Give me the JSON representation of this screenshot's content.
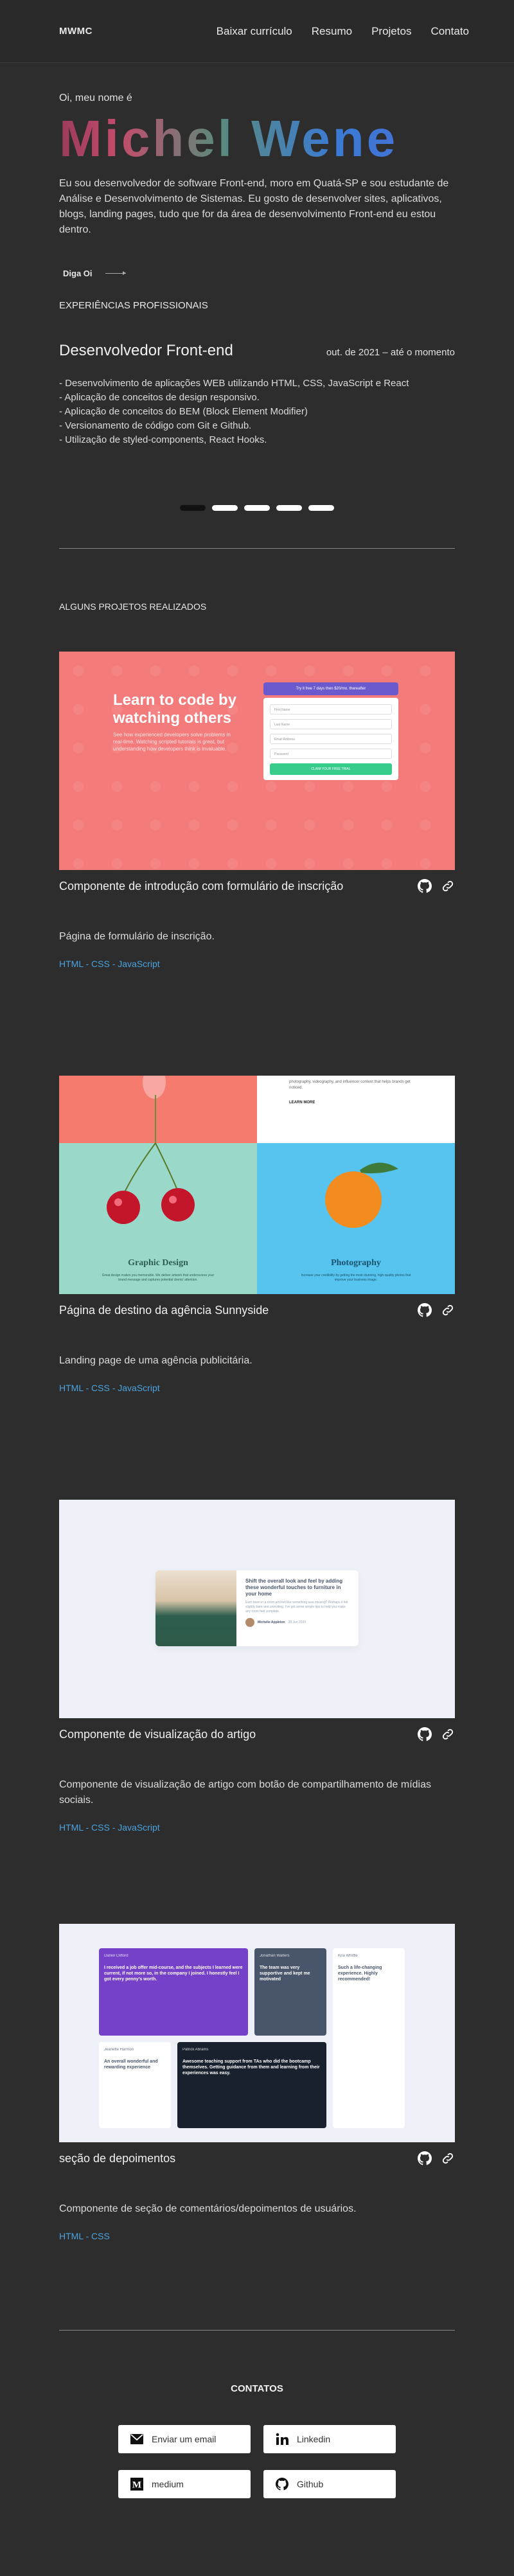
{
  "header": {
    "logo": "MWMC",
    "nav": [
      "Baixar currículo",
      "Resumo",
      "Projetos",
      "Contato"
    ]
  },
  "hero": {
    "greeting": "Oi, meu nome é",
    "name": "Michel Wene",
    "about": "Eu sou desenvolvedor de software Front-end, moro em Quatá-SP e sou estudante de Análise e Desenvolvimento de Sistemas. Eu gosto de desenvolver sites, aplicativos, blogs, landing pages, tudo que for da área de desenvolvimento Front-end eu estou dentro.",
    "say_hi": "Diga Oi"
  },
  "experience": {
    "title": "EXPERIÊNCIAS PROFISSIONAIS",
    "role": "Desenvolvedor Front-end",
    "date": "out. de 2021 – até o momento",
    "items": [
      "- Desenvolvimento de aplicações WEB utilizando HTML, CSS, JavaScript e React",
      "- Aplicação de conceitos de design responsivo.",
      "- Aplicação de conceitos do BEM (Block Element Modifier)",
      "- Versionamento de código com Git e Github.",
      "- Utilização de styled-components, React Hooks."
    ],
    "slide_count": 5,
    "active_slide": 1
  },
  "projects": {
    "title": "ALGUNS PROJETOS REALIZADOS",
    "items": [
      {
        "title": "Componente de introdução com formulário de inscrição",
        "description": "Página de formulário de inscrição.",
        "tags": "HTML - CSS - JavaScript",
        "thumb": {
          "heading": "Learn to code by watching others",
          "sub": "See how experienced developers solve problems in real-time. Watching scripted tutorials is great, but understanding how developers think is invaluable.",
          "banner": "Try it free 7 days then $20/mo. thereafter",
          "fields": [
            "First Name",
            "Last Name",
            "Email Address",
            "Password"
          ],
          "button": "CLAIM YOUR FREE TRIAL"
        }
      },
      {
        "title": "Página de destino da agência Sunnyside",
        "description": "Landing page de uma agência publicitária.",
        "tags": "HTML - CSS - JavaScript",
        "thumb": {
          "top_text": "photography, videography, and influencer content that helps brands get noticed.",
          "learn_more": "LEARN MORE",
          "left_label": "Graphic Design",
          "left_small": "Great design makes you memorable. We deliver artwork that underscores your brand message and captures potential clients' attention.",
          "right_label": "Photography",
          "right_small": "Increase your credibility by getting the most stunning, high-quality photos that improve your business image."
        }
      },
      {
        "title": "Componente de visualização do artigo",
        "description": "Componente de visualização de artigo com botão de compartilhamento de mídias sociais.",
        "tags": "HTML - CSS - JavaScript",
        "thumb": {
          "heading": "Shift the overall look and feel by adding these wonderful touches to furniture in your home",
          "text": "Ever been in a room and felt like something was missing? Perhaps it felt slightly bare and uninviting. I've got some simple tips to help you make any room feel complete.",
          "author": "Michelle Appleton",
          "date": "28 Jun 2020"
        }
      },
      {
        "title": "seção de depoimentos",
        "description": "Componente de seção de comentários/depoimentos de usuários.",
        "tags": "HTML - CSS",
        "thumb": {
          "c1_name": "Daniel Clifford",
          "c1_text": "I received a job offer mid-course, and the subjects I learned were current, if not more so, in the company I joined. I honestly feel I got every penny's worth.",
          "c2_name": "Jonathan Walters",
          "c2_text": "The team was very supportive and kept me motivated",
          "c3_name": "Jeanette Harmon",
          "c3_text": "An overall wonderful and rewarding experience",
          "c4_name": "Patrick Abrams",
          "c4_text": "Awesome teaching support from TAs who did the bootcamp themselves. Getting guidance from them and learning from their experiences was easy.",
          "c5_name": "Kira Whittle",
          "c5_text": "Such a life-changing experience. Highly recommended!"
        }
      }
    ]
  },
  "contacts": {
    "title": "CONTATOS",
    "buttons": [
      {
        "label": "Enviar um email",
        "icon": "mail-icon"
      },
      {
        "label": "Linkedin",
        "icon": "linkedin-icon"
      },
      {
        "label": "medium",
        "icon": "medium-icon"
      },
      {
        "label": "Github",
        "icon": "github-icon"
      }
    ]
  }
}
